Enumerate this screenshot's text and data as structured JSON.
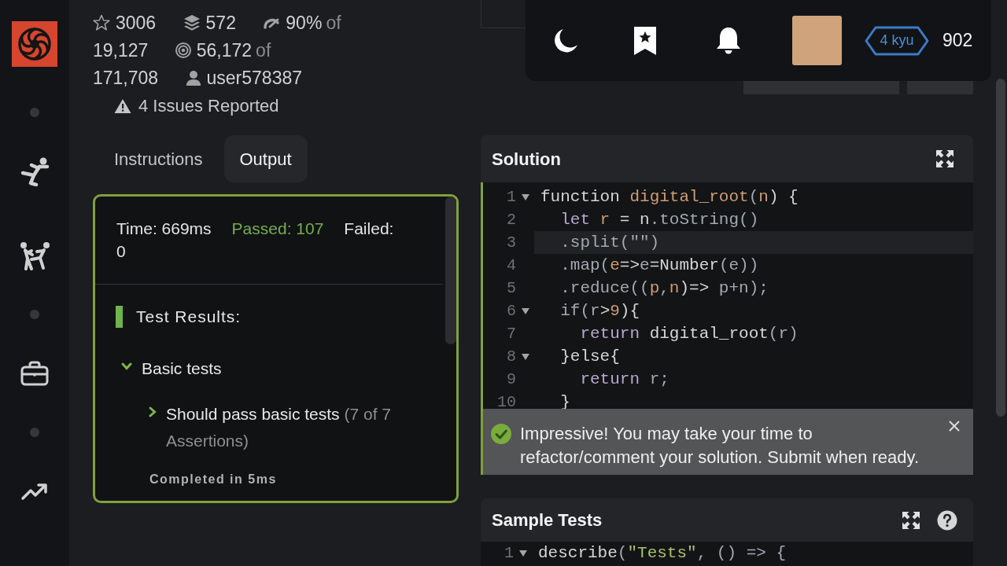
{
  "sidebar": {
    "items": [
      {
        "kind": "logo"
      },
      {
        "kind": "dot"
      },
      {
        "kind": "kick"
      },
      {
        "kind": "sparring"
      },
      {
        "kind": "dot"
      },
      {
        "kind": "briefcase"
      },
      {
        "kind": "dot"
      },
      {
        "kind": "trend"
      }
    ]
  },
  "kata_stats": [
    {
      "kind": "stars",
      "value": "3006"
    },
    {
      "kind": "collections",
      "value": "572"
    },
    {
      "kind": "satisfaction",
      "value": "90%",
      "connector": "of",
      "total": "19,127"
    },
    {
      "kind": "completions",
      "value": "56,172",
      "connector": "of",
      "total": "171,708"
    },
    {
      "kind": "author",
      "value": "user578387"
    }
  ],
  "issues": {
    "label": "4 Issues Reported"
  },
  "top_bar": {
    "rank": "4 kyu",
    "honor": "902"
  },
  "tabs": [
    {
      "label": "Instructions",
      "selected": false
    },
    {
      "label": "Output",
      "selected": true
    }
  ],
  "output": {
    "summary": [
      {
        "kind": "time",
        "text": "Time: 669ms"
      },
      {
        "kind": "passed",
        "text": "Passed: 107"
      },
      {
        "kind": "failed",
        "text": "Failed:",
        "value": "0"
      }
    ],
    "results_title": "Test Results:",
    "groups": [
      {
        "label": "Basic tests",
        "expanded": true,
        "passed": true,
        "children": [
          {
            "label": "Should pass basic tests",
            "count": "(7 of 7 Assertions)",
            "expanded": false,
            "passed": true
          }
        ],
        "completed": "Completed in 5ms"
      }
    ]
  },
  "solution": {
    "title": "Solution",
    "lines": [
      {
        "number": "1",
        "foldable": true,
        "active": false,
        "tokens": [
          {
            "text": "function ",
            "kind": "plain"
          },
          {
            "text": "digital_root",
            "kind": "name"
          },
          {
            "text": "(",
            "kind": "muted"
          },
          {
            "text": "n",
            "kind": "name"
          },
          {
            "text": ") {",
            "kind": "plain"
          }
        ]
      },
      {
        "number": "2",
        "foldable": false,
        "active": false,
        "tokens": [
          {
            "text": "  let",
            "kind": "keyword"
          },
          {
            "text": " r",
            "kind": "name"
          },
          {
            "text": " = ",
            "kind": "plain"
          },
          {
            "text": "n",
            "kind": "plain"
          },
          {
            "text": ".toString()",
            "kind": "muted"
          }
        ]
      },
      {
        "number": "3",
        "foldable": false,
        "active": true,
        "tokens": [
          {
            "text": "  .split(\"\")",
            "kind": "muted"
          }
        ]
      },
      {
        "number": "4",
        "foldable": false,
        "active": false,
        "tokens": [
          {
            "text": "  .map(",
            "kind": "muted"
          },
          {
            "text": "e",
            "kind": "name"
          },
          {
            "text": "=>",
            "kind": "plain"
          },
          {
            "text": "e",
            "kind": "muted"
          },
          {
            "text": "=Number",
            "kind": "plain"
          },
          {
            "text": "(e))",
            "kind": "muted"
          }
        ]
      },
      {
        "number": "5",
        "foldable": false,
        "active": false,
        "tokens": [
          {
            "text": "  .reduce((",
            "kind": "muted"
          },
          {
            "text": "p",
            "kind": "name"
          },
          {
            "text": ",",
            "kind": "muted"
          },
          {
            "text": "n",
            "kind": "name"
          },
          {
            "text": ")=>",
            "kind": "plain"
          },
          {
            "text": " p+n);",
            "kind": "muted"
          }
        ]
      },
      {
        "number": "6",
        "foldable": true,
        "active": false,
        "tokens": [
          {
            "text": "  if(r",
            "kind": "muted"
          },
          {
            "text": ">",
            "kind": "plain"
          },
          {
            "text": "9",
            "kind": "name"
          },
          {
            "text": "){",
            "kind": "plain"
          }
        ]
      },
      {
        "number": "7",
        "foldable": false,
        "active": false,
        "tokens": [
          {
            "text": "    return",
            "kind": "keyword"
          },
          {
            "text": " digital_root",
            "kind": "plain"
          },
          {
            "text": "(r)",
            "kind": "muted"
          }
        ]
      },
      {
        "number": "8",
        "foldable": true,
        "active": false,
        "tokens": [
          {
            "text": "  }else{",
            "kind": "plain"
          }
        ]
      },
      {
        "number": "9",
        "foldable": false,
        "active": false,
        "tokens": [
          {
            "text": "    return",
            "kind": "keyword"
          },
          {
            "text": " r;",
            "kind": "muted"
          }
        ]
      },
      {
        "number": "10",
        "foldable": false,
        "active": false,
        "tokens": [
          {
            "text": "  }",
            "kind": "plain"
          }
        ]
      }
    ]
  },
  "toast": {
    "message": "Impressive! You may take your time to refactor/comment your solution. Submit when ready."
  },
  "sample_tests": {
    "title": "Sample Tests",
    "lines": [
      {
        "number": "1",
        "foldable": true,
        "active": false,
        "tokens": [
          {
            "text": "describe",
            "kind": "plain"
          },
          {
            "text": "(",
            "kind": "muted"
          },
          {
            "text": "\"Tests\"",
            "kind": "string"
          },
          {
            "text": ", () => {",
            "kind": "muted"
          }
        ]
      }
    ]
  }
}
